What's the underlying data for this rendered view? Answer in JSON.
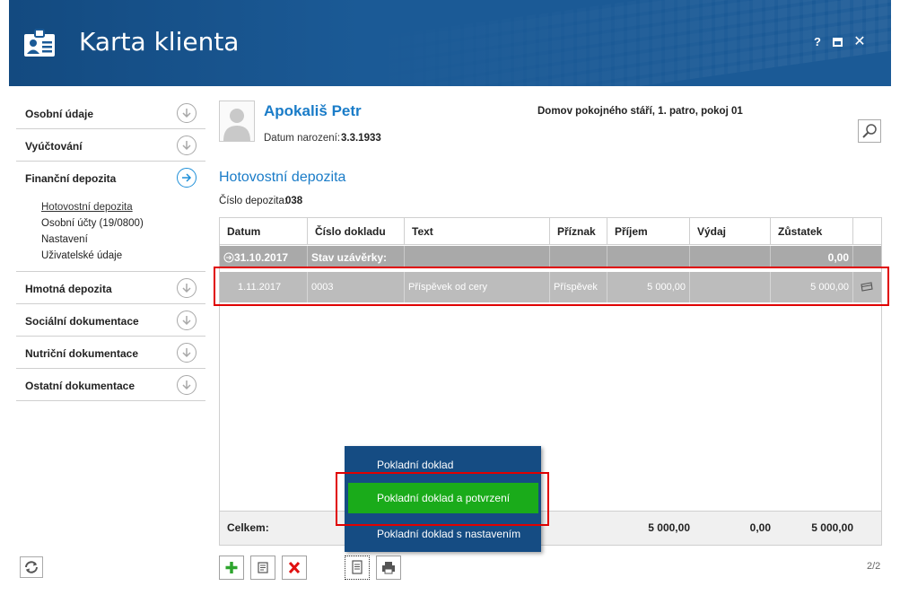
{
  "window": {
    "title": "Karta klienta",
    "help_label": "?",
    "close_label": "✕"
  },
  "sidebar": {
    "items": [
      {
        "label": "Osobní údaje"
      },
      {
        "label": "Vyúčtování"
      },
      {
        "label": "Finanční depozita"
      },
      {
        "label": "Hmotná depozita"
      },
      {
        "label": "Sociální dokumentace"
      },
      {
        "label": "Nutriční dokumentace"
      },
      {
        "label": "Ostatní dokumentace"
      }
    ],
    "subitems": [
      {
        "label": "Hotovostní depozita"
      },
      {
        "label": "Osobní účty (19/0800)"
      },
      {
        "label": "Nastavení"
      },
      {
        "label": "Uživatelské údaje"
      }
    ]
  },
  "client": {
    "name": "Apokališ Petr",
    "dob_label": "Datum narození:",
    "dob": "3.3.1933",
    "location": "Domov pokojného stáří, 1. patro, pokoj 01"
  },
  "section": {
    "title": "Hotovostní depozita",
    "deposit_label": "Číslo depozita:",
    "deposit_number": "038"
  },
  "table": {
    "headers": [
      "Datum",
      "Číslo dokladu",
      "Text",
      "Příznak",
      "Příjem",
      "Výdaj",
      "Zůstatek"
    ],
    "closing_row": {
      "date": "31.10.2017",
      "label": "Stav uzávěrky:",
      "balance": "0,00"
    },
    "rows": [
      {
        "date": "1.11.2017",
        "doc_number": "0003",
        "text": "Příspěvek od cery",
        "flag": "Příspěvek",
        "income": "5 000,00",
        "expense": "",
        "balance": "5 000,00"
      }
    ],
    "totals": {
      "label": "Celkem:",
      "income": "5 000,00",
      "expense": "0,00",
      "balance": "5 000,00"
    }
  },
  "popup_menu": {
    "items": [
      {
        "label": "Pokladní doklad"
      },
      {
        "label": "Pokladní doklad a potvrzení"
      },
      {
        "label": "Pokladní doklad s nastavením"
      }
    ],
    "selected_index": 1
  },
  "pagination": {
    "text": "2/2"
  },
  "colors": {
    "header_bg": "#1b5a96",
    "accent_blue": "#1a7cc8",
    "highlight_red": "#e00000",
    "menu_selected_green": "#1aab1a",
    "menu_bg": "#154c83"
  }
}
